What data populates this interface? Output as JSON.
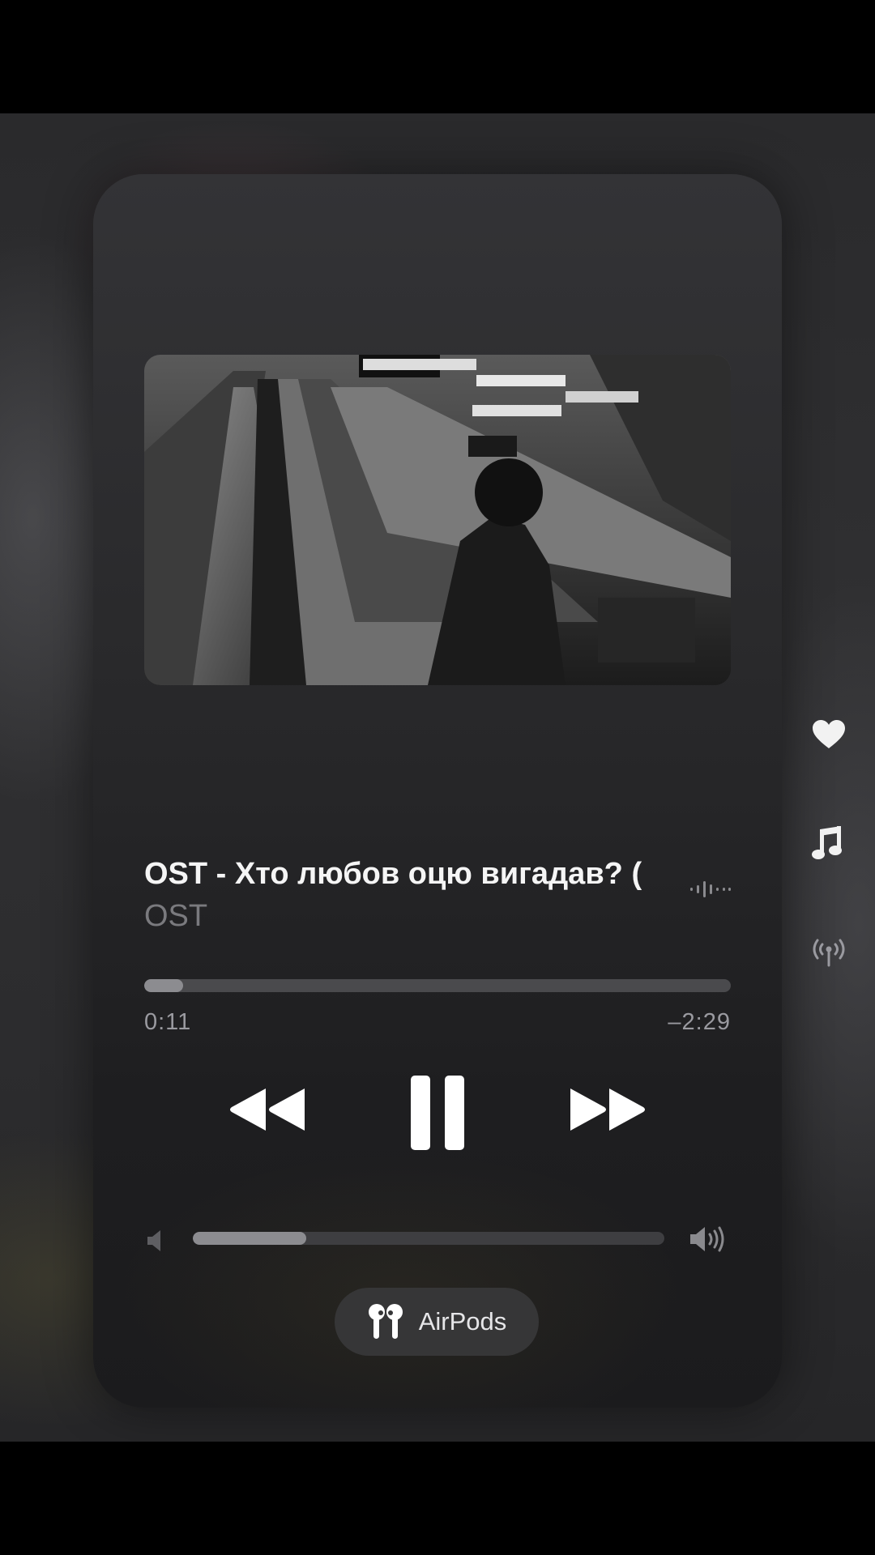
{
  "track": {
    "title": "OST - Хто любов оцю вигадав? (",
    "artist": "OST"
  },
  "playback": {
    "elapsed": "0:11",
    "remaining": "–2:29",
    "progress_fraction": 0.066,
    "state": "playing"
  },
  "volume": {
    "level_fraction": 0.24
  },
  "output_device": {
    "label": "AirPods",
    "icon": "airpods-icon"
  },
  "side_icons": [
    "heart-icon",
    "music-note-icon",
    "broadcast-icon"
  ],
  "colors": {
    "background": "#000000",
    "card": "#2a2a2c",
    "title": "#f5f5f5",
    "artist": "#7a7a7e",
    "progress_fill": "#8c8c90",
    "track": "#4a4a4d"
  }
}
